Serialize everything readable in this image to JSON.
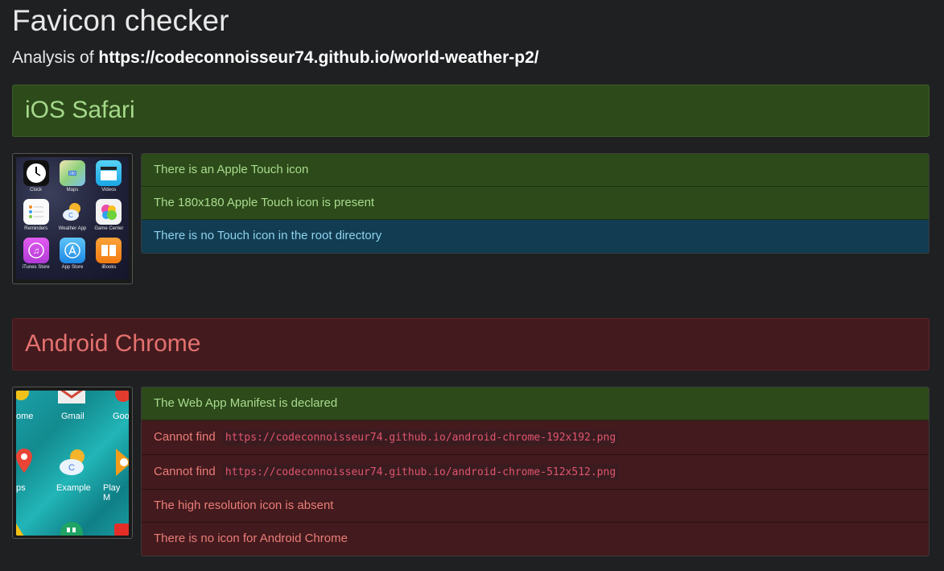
{
  "page": {
    "title": "Favicon checker",
    "analysis_prefix": "Analysis of",
    "analysis_url": "https://codeconnoisseur74.github.io/world-weather-p2/"
  },
  "ios": {
    "heading": "iOS Safari",
    "screen_apps": [
      "Clock",
      "Maps",
      "Videos",
      "Reminders",
      "Weather App",
      "Game Center",
      "iTunes Store",
      "App Store",
      "iBooks"
    ],
    "results": [
      {
        "status": "ok",
        "text": "There is an Apple Touch icon"
      },
      {
        "status": "ok",
        "text": "The 180x180 Apple Touch icon is present"
      },
      {
        "status": "info",
        "text": "There is no Touch icon in the root directory"
      }
    ]
  },
  "android": {
    "heading": "Android Chrome",
    "screen_labels": [
      "ome",
      "Gmail",
      "Goo",
      "ps",
      "Example",
      "Play M"
    ],
    "results": [
      {
        "status": "ok",
        "text": "The Web App Manifest is declared"
      },
      {
        "status": "bad",
        "text": "Cannot find",
        "code": "https://codeconnoisseur74.github.io/android-chrome-192x192.png"
      },
      {
        "status": "bad",
        "text": "Cannot find",
        "code": "https://codeconnoisseur74.github.io/android-chrome-512x512.png"
      },
      {
        "status": "bad",
        "text": "The high resolution icon is absent"
      },
      {
        "status": "bad",
        "text": "There is no icon for Android Chrome"
      }
    ]
  },
  "colors": {
    "ok_bg": "#2d4a1a",
    "ok_text": "#a8dc8e",
    "info_bg": "#113c52",
    "info_text": "#8fd2ee",
    "bad_bg": "#431a1d",
    "bad_text": "#ea7d79",
    "page_bg": "#1f2022"
  }
}
